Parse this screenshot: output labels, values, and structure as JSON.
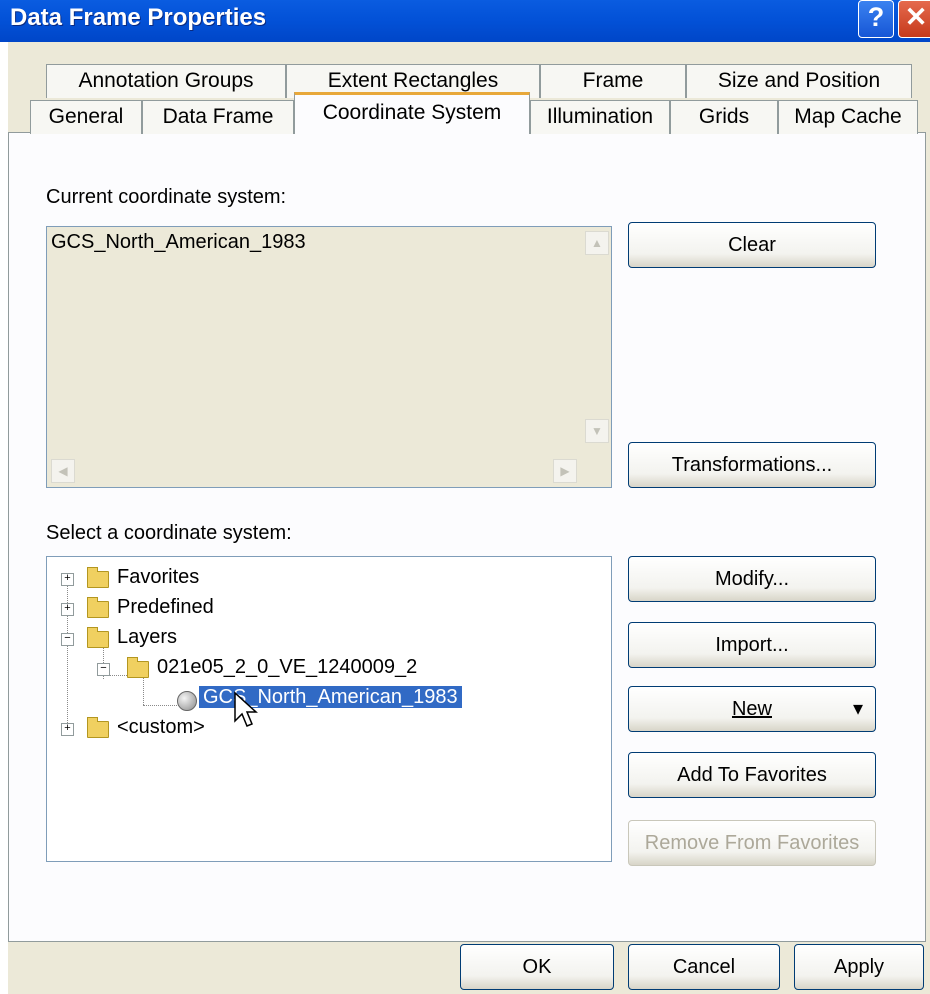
{
  "window": {
    "title": "Data Frame Properties",
    "help_glyph": "?",
    "close_glyph": "✕"
  },
  "tabs_row1": [
    "Annotation Groups",
    "Extent Rectangles",
    "Frame",
    "Size and Position"
  ],
  "tabs_row2": [
    "General",
    "Data Frame",
    "Coordinate System",
    "Illumination",
    "Grids",
    "Map Cache"
  ],
  "selected_tab": "Coordinate System",
  "current": {
    "label": "Current coordinate system:",
    "value": "GCS_North_American_1983"
  },
  "select": {
    "label": "Select a coordinate system:"
  },
  "tree": {
    "favorites": "Favorites",
    "predefined": "Predefined",
    "layers": "Layers",
    "layer_folder": "021e05_2_0_VE_1240009_2",
    "layer_cs": "GCS_North_American_1983",
    "custom": "<custom>"
  },
  "buttons": {
    "clear": "Clear",
    "transformations": "Transformations...",
    "modify": "Modify...",
    "import": "Import...",
    "new": "New",
    "new_arrow": "▾",
    "add_favorites": "Add To Favorites",
    "remove_favorites": "Remove From Favorites",
    "ok": "OK",
    "cancel": "Cancel",
    "apply": "Apply"
  },
  "icons": {
    "scroll_up": "▲",
    "scroll_down": "▼",
    "scroll_left": "◀",
    "scroll_right": "▶",
    "expand": "+",
    "collapse": "−"
  },
  "colors": {
    "titlebar": "#0352d8",
    "dialog_bg": "#ece9d8",
    "selection": "#316ac5",
    "tab_highlight": "#e8a83a"
  }
}
